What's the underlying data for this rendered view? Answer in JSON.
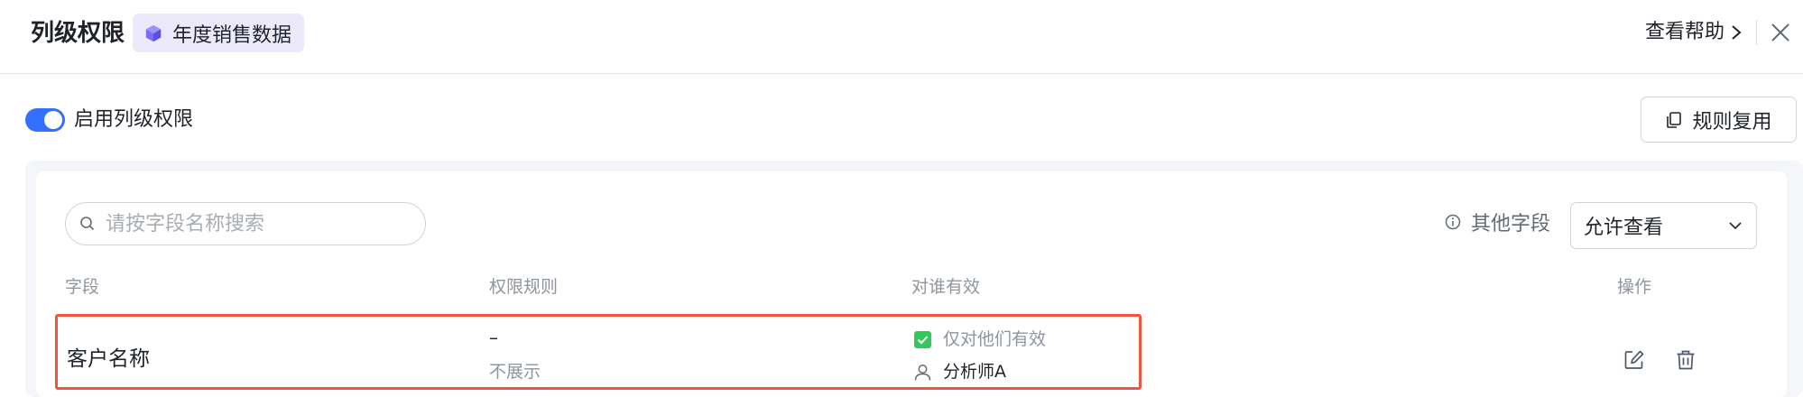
{
  "header": {
    "title": "列级权限",
    "dataset_tag": "年度销售数据",
    "help_label": "查看帮助"
  },
  "toggle": {
    "label": "启用列级权限",
    "enabled": true
  },
  "reuse_button": {
    "label": "规则复用"
  },
  "search": {
    "placeholder": "请按字段名称搜索",
    "value": ""
  },
  "other_fields": {
    "label": "其他字段",
    "selected": "允许查看"
  },
  "table": {
    "columns": {
      "field": "字段",
      "rule": "权限规则",
      "effective_for": "对谁有效",
      "actions": "操作"
    },
    "rows": [
      {
        "field": "客户名称",
        "rule_value": "–",
        "rule_desc": "不展示",
        "scope_label": "仅对他们有效",
        "member": "分析师A"
      }
    ]
  },
  "colors": {
    "accent": "#3370ff",
    "tag_bg": "#ece9fb",
    "tag_icon": "#7b6cf6",
    "highlight_border": "#f0563f",
    "check_green": "#34c759"
  },
  "icons": {
    "dataset": "cube-icon",
    "help": "chevron-right-icon",
    "close": "close-icon",
    "reuse": "copy-icon",
    "search": "search-icon",
    "info": "info-icon",
    "dropdown": "chevron-down-icon",
    "scope": "checkbox-checked-icon",
    "member": "user-icon",
    "edit": "edit-icon",
    "delete": "trash-icon"
  }
}
